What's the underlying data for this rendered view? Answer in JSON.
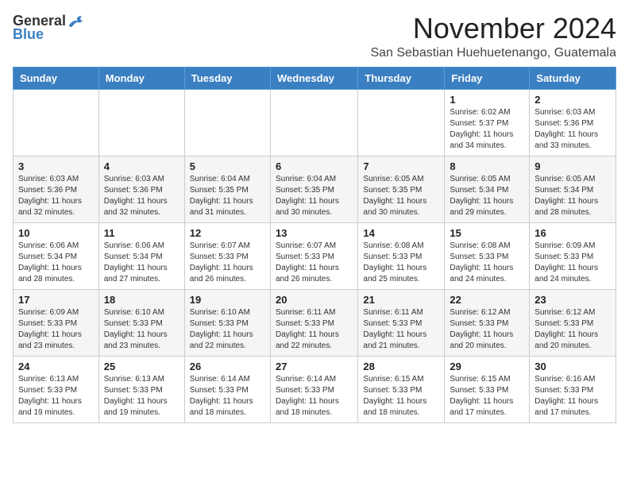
{
  "header": {
    "logo_general": "General",
    "logo_blue": "Blue",
    "month_title": "November 2024",
    "location": "San Sebastian Huehuetenango, Guatemala"
  },
  "days_of_week": [
    "Sunday",
    "Monday",
    "Tuesday",
    "Wednesday",
    "Thursday",
    "Friday",
    "Saturday"
  ],
  "weeks": [
    [
      {
        "day": "",
        "info": ""
      },
      {
        "day": "",
        "info": ""
      },
      {
        "day": "",
        "info": ""
      },
      {
        "day": "",
        "info": ""
      },
      {
        "day": "",
        "info": ""
      },
      {
        "day": "1",
        "info": "Sunrise: 6:02 AM\nSunset: 5:37 PM\nDaylight: 11 hours and 34 minutes."
      },
      {
        "day": "2",
        "info": "Sunrise: 6:03 AM\nSunset: 5:36 PM\nDaylight: 11 hours and 33 minutes."
      }
    ],
    [
      {
        "day": "3",
        "info": "Sunrise: 6:03 AM\nSunset: 5:36 PM\nDaylight: 11 hours and 32 minutes."
      },
      {
        "day": "4",
        "info": "Sunrise: 6:03 AM\nSunset: 5:36 PM\nDaylight: 11 hours and 32 minutes."
      },
      {
        "day": "5",
        "info": "Sunrise: 6:04 AM\nSunset: 5:35 PM\nDaylight: 11 hours and 31 minutes."
      },
      {
        "day": "6",
        "info": "Sunrise: 6:04 AM\nSunset: 5:35 PM\nDaylight: 11 hours and 30 minutes."
      },
      {
        "day": "7",
        "info": "Sunrise: 6:05 AM\nSunset: 5:35 PM\nDaylight: 11 hours and 30 minutes."
      },
      {
        "day": "8",
        "info": "Sunrise: 6:05 AM\nSunset: 5:34 PM\nDaylight: 11 hours and 29 minutes."
      },
      {
        "day": "9",
        "info": "Sunrise: 6:05 AM\nSunset: 5:34 PM\nDaylight: 11 hours and 28 minutes."
      }
    ],
    [
      {
        "day": "10",
        "info": "Sunrise: 6:06 AM\nSunset: 5:34 PM\nDaylight: 11 hours and 28 minutes."
      },
      {
        "day": "11",
        "info": "Sunrise: 6:06 AM\nSunset: 5:34 PM\nDaylight: 11 hours and 27 minutes."
      },
      {
        "day": "12",
        "info": "Sunrise: 6:07 AM\nSunset: 5:33 PM\nDaylight: 11 hours and 26 minutes."
      },
      {
        "day": "13",
        "info": "Sunrise: 6:07 AM\nSunset: 5:33 PM\nDaylight: 11 hours and 26 minutes."
      },
      {
        "day": "14",
        "info": "Sunrise: 6:08 AM\nSunset: 5:33 PM\nDaylight: 11 hours and 25 minutes."
      },
      {
        "day": "15",
        "info": "Sunrise: 6:08 AM\nSunset: 5:33 PM\nDaylight: 11 hours and 24 minutes."
      },
      {
        "day": "16",
        "info": "Sunrise: 6:09 AM\nSunset: 5:33 PM\nDaylight: 11 hours and 24 minutes."
      }
    ],
    [
      {
        "day": "17",
        "info": "Sunrise: 6:09 AM\nSunset: 5:33 PM\nDaylight: 11 hours and 23 minutes."
      },
      {
        "day": "18",
        "info": "Sunrise: 6:10 AM\nSunset: 5:33 PM\nDaylight: 11 hours and 23 minutes."
      },
      {
        "day": "19",
        "info": "Sunrise: 6:10 AM\nSunset: 5:33 PM\nDaylight: 11 hours and 22 minutes."
      },
      {
        "day": "20",
        "info": "Sunrise: 6:11 AM\nSunset: 5:33 PM\nDaylight: 11 hours and 22 minutes."
      },
      {
        "day": "21",
        "info": "Sunrise: 6:11 AM\nSunset: 5:33 PM\nDaylight: 11 hours and 21 minutes."
      },
      {
        "day": "22",
        "info": "Sunrise: 6:12 AM\nSunset: 5:33 PM\nDaylight: 11 hours and 20 minutes."
      },
      {
        "day": "23",
        "info": "Sunrise: 6:12 AM\nSunset: 5:33 PM\nDaylight: 11 hours and 20 minutes."
      }
    ],
    [
      {
        "day": "24",
        "info": "Sunrise: 6:13 AM\nSunset: 5:33 PM\nDaylight: 11 hours and 19 minutes."
      },
      {
        "day": "25",
        "info": "Sunrise: 6:13 AM\nSunset: 5:33 PM\nDaylight: 11 hours and 19 minutes."
      },
      {
        "day": "26",
        "info": "Sunrise: 6:14 AM\nSunset: 5:33 PM\nDaylight: 11 hours and 18 minutes."
      },
      {
        "day": "27",
        "info": "Sunrise: 6:14 AM\nSunset: 5:33 PM\nDaylight: 11 hours and 18 minutes."
      },
      {
        "day": "28",
        "info": "Sunrise: 6:15 AM\nSunset: 5:33 PM\nDaylight: 11 hours and 18 minutes."
      },
      {
        "day": "29",
        "info": "Sunrise: 6:15 AM\nSunset: 5:33 PM\nDaylight: 11 hours and 17 minutes."
      },
      {
        "day": "30",
        "info": "Sunrise: 6:16 AM\nSunset: 5:33 PM\nDaylight: 11 hours and 17 minutes."
      }
    ]
  ]
}
